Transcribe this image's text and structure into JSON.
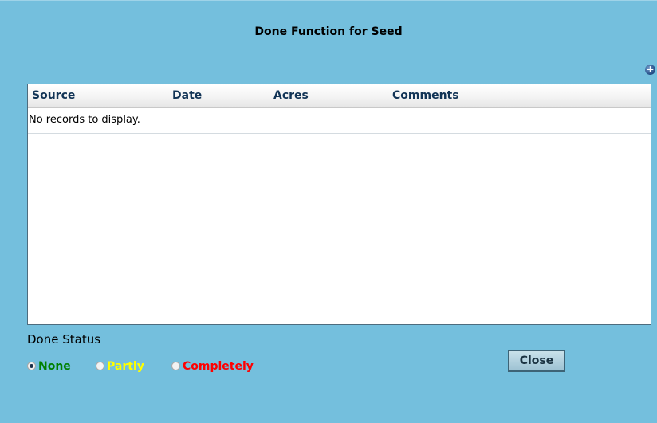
{
  "dialog": {
    "title": "Done Function for Seed",
    "add_icon": "plus-circle-icon"
  },
  "grid": {
    "columns": [
      "Source",
      "Date",
      "Acres",
      "Comments"
    ],
    "empty_message": "No records to display."
  },
  "done_status": {
    "label": "Done Status",
    "options": [
      {
        "label": "None",
        "color": "#008000",
        "selected": true
      },
      {
        "label": "Partly",
        "color": "#ffff00",
        "selected": false
      },
      {
        "label": "Completely",
        "color": "#ff0000",
        "selected": false
      }
    ]
  },
  "close_label": "Close",
  "colors": {
    "background": "#74bfdd",
    "grid_border": "#4d6c7e",
    "header_text": "#123456"
  }
}
